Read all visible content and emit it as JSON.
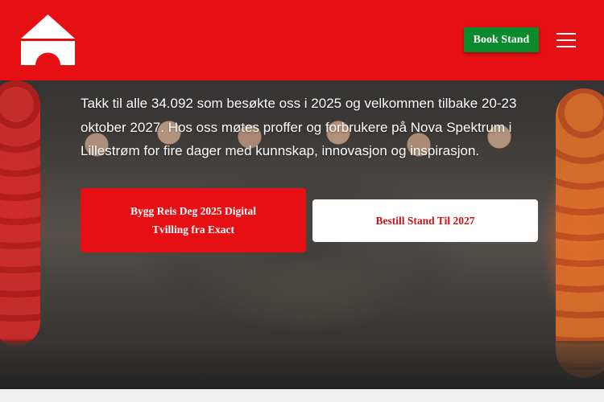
{
  "colors": {
    "brand_red": "#e60f14",
    "book_green": "#0c8a2e",
    "white": "#ffffff",
    "below_hero": "#efefef"
  },
  "header": {
    "logo_icon": "stand-tent-logo",
    "book_button_label": "Book Stand",
    "menu_icon": "hamburger-menu-icon"
  },
  "hero": {
    "background_icon": "crowd-photo-with-balloons",
    "intro_text": "Takk til alle 34.092 som besøkte oss i 2025 og velkommen tilbake 20-23 oktober 2027. Hos oss møtes proffer og forbrukere på Nova Spektrum i Lillestrøm for fire dager med kunnskap, innovasjon og inspirasjon.",
    "primary_cta_label": "Bygg Reis Deg 2025 Digital Tvilling fra Exact",
    "secondary_cta_label": "Bestill Stand Til 2027"
  }
}
